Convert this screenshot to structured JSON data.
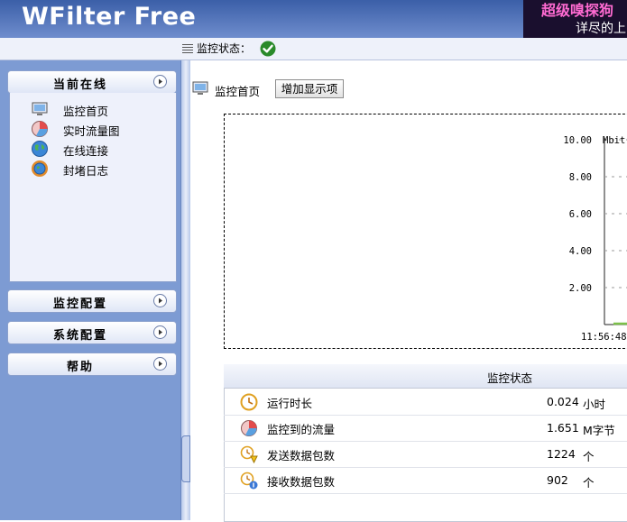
{
  "app": {
    "title": "WFilter Free"
  },
  "banner": {
    "line1": "超级嗅探狗",
    "line2": "详尽的上"
  },
  "statusbar": {
    "label": "监控状态：",
    "status_icon": "check-circle-icon",
    "status_color": "#2a8a2a"
  },
  "sidebar": {
    "sections": [
      {
        "label": "当前在线",
        "expanded": true,
        "items": [
          {
            "label": "监控首页",
            "icon": "monitor-icon"
          },
          {
            "label": "实时流量图",
            "icon": "pie-chart-icon"
          },
          {
            "label": "在线连接",
            "icon": "globe-icon"
          },
          {
            "label": "封堵日志",
            "icon": "gear-globe-icon"
          }
        ]
      },
      {
        "label": "监控配置",
        "expanded": false
      },
      {
        "label": "系统配置",
        "expanded": false
      },
      {
        "label": "帮助",
        "expanded": false
      }
    ]
  },
  "main": {
    "tab_label": "监控首页",
    "add_button": "增加显示项",
    "chart": {
      "y_unit": "Mbit",
      "y_ticks": [
        "10.00",
        "8.00",
        "6.00",
        "4.00",
        "2.00"
      ],
      "x_label": "11:56:48"
    },
    "status_table": {
      "header": "监控状态",
      "rows": [
        {
          "name": "运行时长",
          "value": "0.024",
          "unit": "小时",
          "icon": "clock-icon"
        },
        {
          "name": "监控到的流量",
          "value": "1.651",
          "unit": "M字节",
          "icon": "pie-chart-icon"
        },
        {
          "name": "发送数据包数",
          "value": "1224",
          "unit": "个",
          "icon": "packet-send-icon"
        },
        {
          "name": "接收数据包数",
          "value": "902",
          "unit": "个",
          "icon": "packet-receive-icon"
        }
      ]
    }
  },
  "chart_data": {
    "type": "line",
    "title": "",
    "ylabel": "Mbit",
    "ylim": [
      0,
      10
    ],
    "y_ticks": [
      10.0,
      8.0,
      6.0,
      4.0,
      2.0
    ],
    "x": [
      "11:56:48"
    ],
    "series": [
      {
        "values": [
          0.0
        ]
      }
    ],
    "grid": true
  }
}
